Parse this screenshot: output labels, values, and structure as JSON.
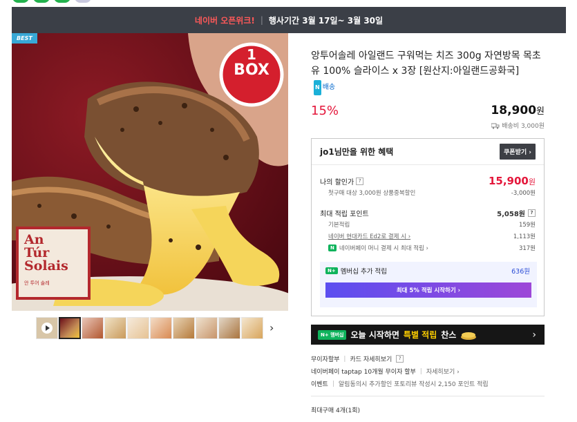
{
  "banner": {
    "highlight": "네이버 오픈위크!",
    "sep": "|",
    "period": "행사기간 3월 17일~ 3월 30일"
  },
  "image": {
    "best_tag": "BEST",
    "box_label_top": "1",
    "box_label_bottom": "BOX",
    "book_title_lines": [
      "An",
      "Túr",
      "Solais"
    ],
    "book_subtitle": "안 투어 솔레"
  },
  "product": {
    "title": "앙투어솔레 아일랜드 구워먹는 치즈 300g 자연방목 목초유 100% 슬라이스 x 3장 [원산지:아일랜드공화국]",
    "delivery_badge_n": "N",
    "delivery_badge": "배송",
    "discount": "15%",
    "price": "18,900",
    "currency": "원",
    "shipping": "배송비 3,000원"
  },
  "benefit": {
    "header": "jo1님만을 위한 혜택",
    "coupon_btn": "쿠폰받기 ›",
    "my_price_label": "나의 할인가",
    "q": "?",
    "my_price": "15,900",
    "my_price_currency": "원",
    "first_purchase_label": "첫구매 대상 3,000원 상품중복할인",
    "first_purchase_value": "-3,000원",
    "max_points_label": "최대 적립 포인트",
    "max_points_value": "5,058원",
    "basic_label": "기본적립",
    "basic_value": "159원",
    "card_label": "네이버 현대카드 Ed2로 결제 시 ›",
    "card_value": "1,113원",
    "npay_label": "네이버페이 머니 결제 시 최대 적립 ›",
    "npay_value": "317원",
    "member_label": "멤버십 추가 적립",
    "member_value": "636원",
    "nplus": "N+",
    "start_btn": "최대 5% 적립 시작하기 ›"
  },
  "promo": {
    "badge": "N+ 멤버십",
    "text_a": "오늘 시작하면",
    "text_b": "특별 적립",
    "text_c": "찬스",
    "chev": "›"
  },
  "info": {
    "interest_free": "무이자할부",
    "card_detail": "카드 자세히보기",
    "q": "?",
    "taptap": "네이버페이 taptap 10개월 무이자 할부",
    "taptap_detail": "자세히보기 ›",
    "event_label": "이벤트",
    "event_text": "알림동의시 추가할인 포토리뷰 작성시 2,150 포인트 적립",
    "max_purchase": "최대구매 4개(1회)"
  },
  "thumb_next": "›"
}
